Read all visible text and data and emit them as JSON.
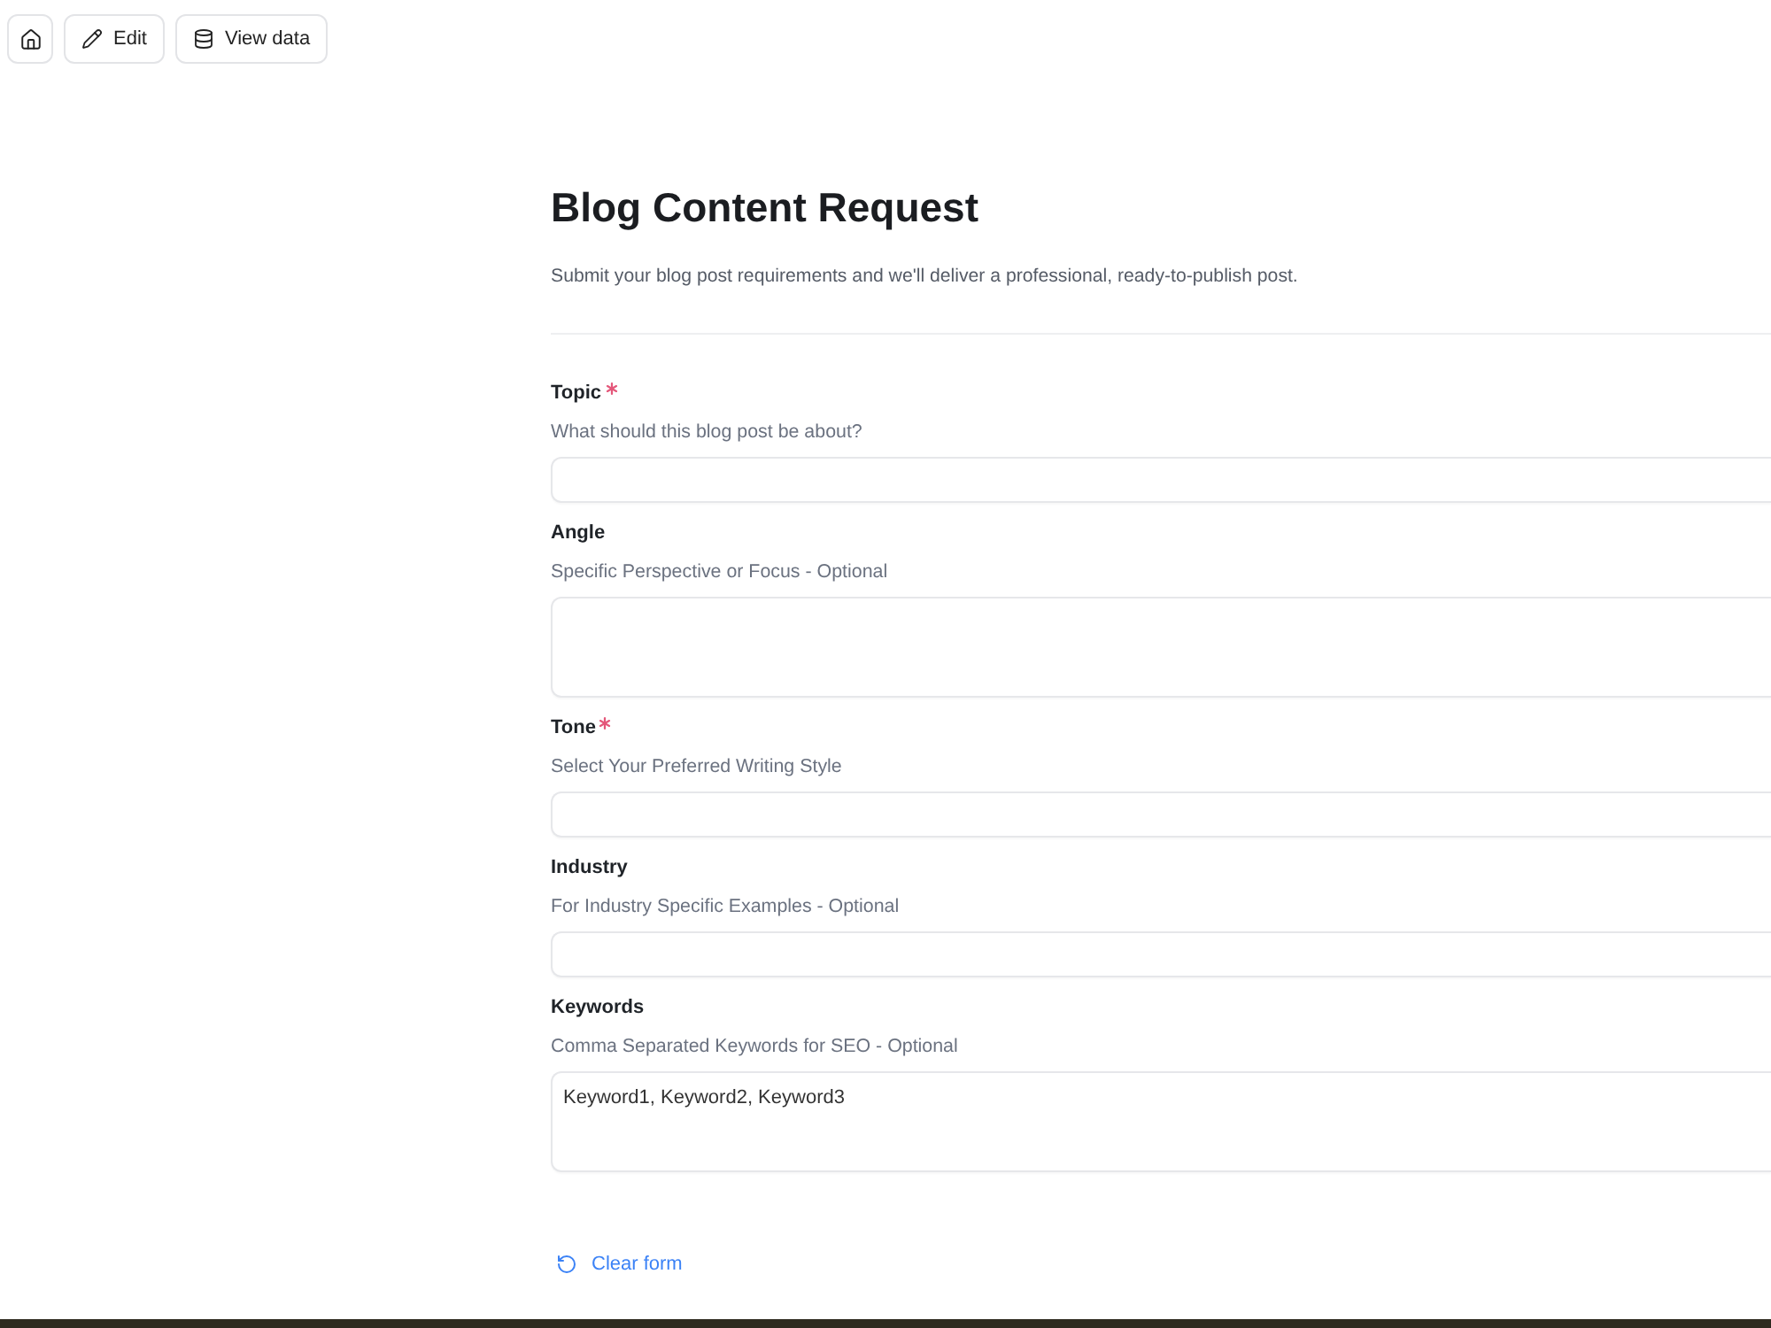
{
  "toolbar": {
    "buttons": [
      {
        "kind": "home"
      },
      {
        "kind": "edit",
        "label": "Edit"
      },
      {
        "kind": "data",
        "label": "View data"
      }
    ]
  },
  "form": {
    "title": "Blog Content Request",
    "description": "Submit your blog post requirements and we'll deliver a professional, ready-to-publish post.",
    "fields": [
      {
        "label": "Topic",
        "required": true,
        "hint": "What should this blog post be about?",
        "kind": "input"
      },
      {
        "label": "Angle",
        "required": false,
        "hint": "Specific Perspective or Focus - Optional",
        "kind": "textarea"
      },
      {
        "label": "Tone",
        "required": true,
        "hint": "Select Your Preferred Writing Style",
        "kind": "input"
      },
      {
        "label": "Industry",
        "required": false,
        "hint": "For Industry Specific Examples - Optional",
        "kind": "input"
      },
      {
        "label": "Keywords",
        "required": false,
        "hint": "Comma Separated Keywords for SEO - Optional",
        "kind": "textarea",
        "value": "Keyword1, Keyword2, Keyword3"
      }
    ],
    "clear_button": {
      "label": "Clear form"
    }
  }
}
